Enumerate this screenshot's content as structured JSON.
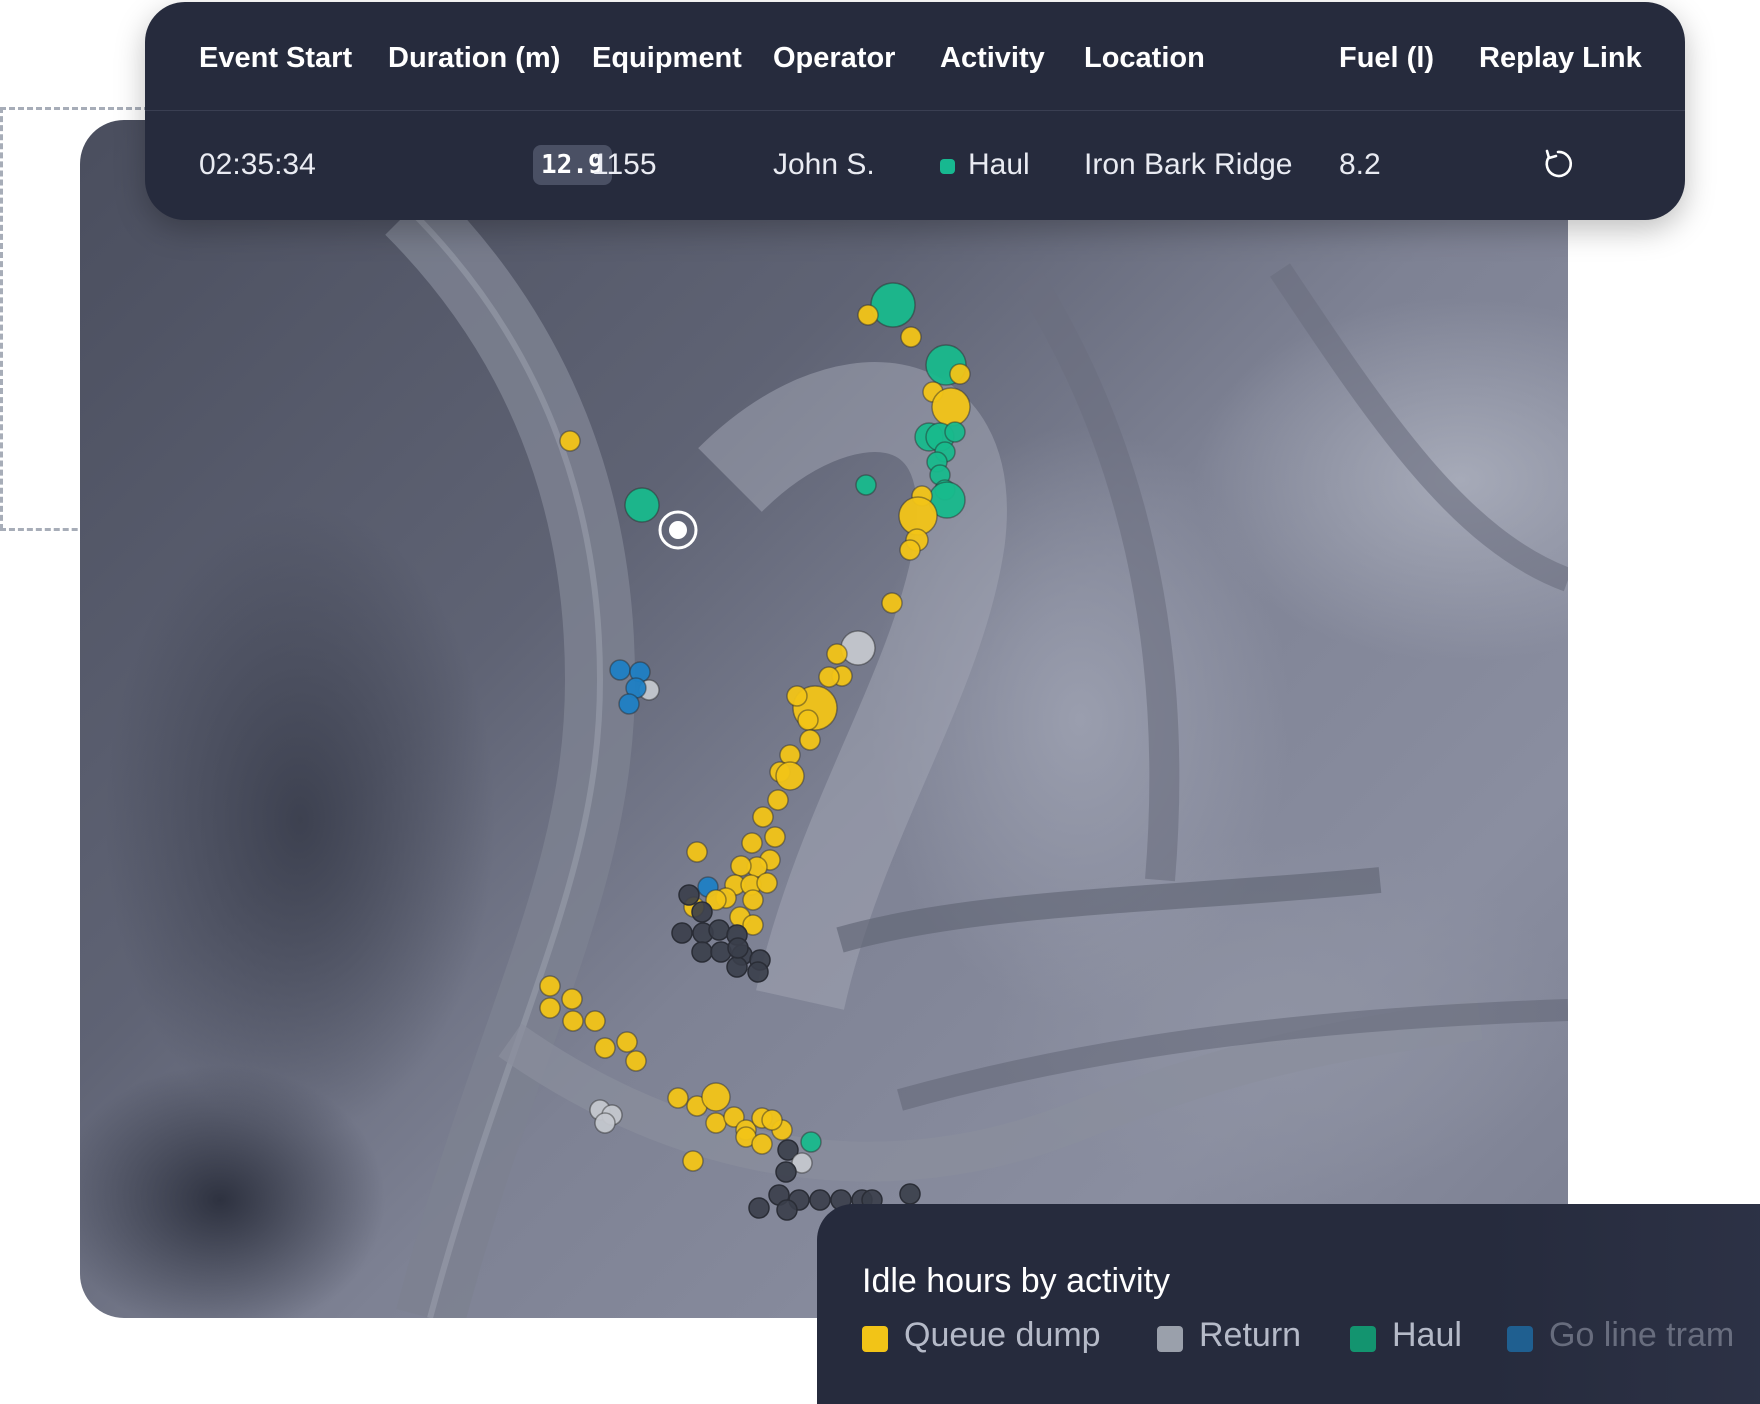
{
  "table": {
    "headers": {
      "event_start": "Event Start",
      "duration": "Duration (m)",
      "equipment": "Equipment",
      "operator": "Operator",
      "activity": "Activity",
      "location": "Location",
      "fuel": "Fuel (l)",
      "replay": "Replay Link"
    },
    "row": {
      "event_start": "02:35:34",
      "duration": "12.9",
      "equipment": "1155",
      "operator": "John S.",
      "activity": "Haul",
      "location": "Iron Bark Ridge",
      "fuel": "8.2",
      "replay_icon": "replay-icon"
    },
    "activity_color": "#17b890"
  },
  "legend": {
    "title": "Idle hours by activity",
    "items": [
      {
        "label": "Queue dump",
        "color": "#f2c417"
      },
      {
        "label": "Return",
        "color": "#9aa0ab"
      },
      {
        "label": "Haul",
        "color": "#13946f"
      },
      {
        "label": "Go line tram",
        "color": "#1f5f90"
      }
    ]
  },
  "map": {
    "colors": {
      "queue_dump": "#f2c417",
      "return": "#c4c7ce",
      "haul": "#18b98c",
      "go_line": "#1f7fc4",
      "other": "#3a3e4a"
    }
  }
}
